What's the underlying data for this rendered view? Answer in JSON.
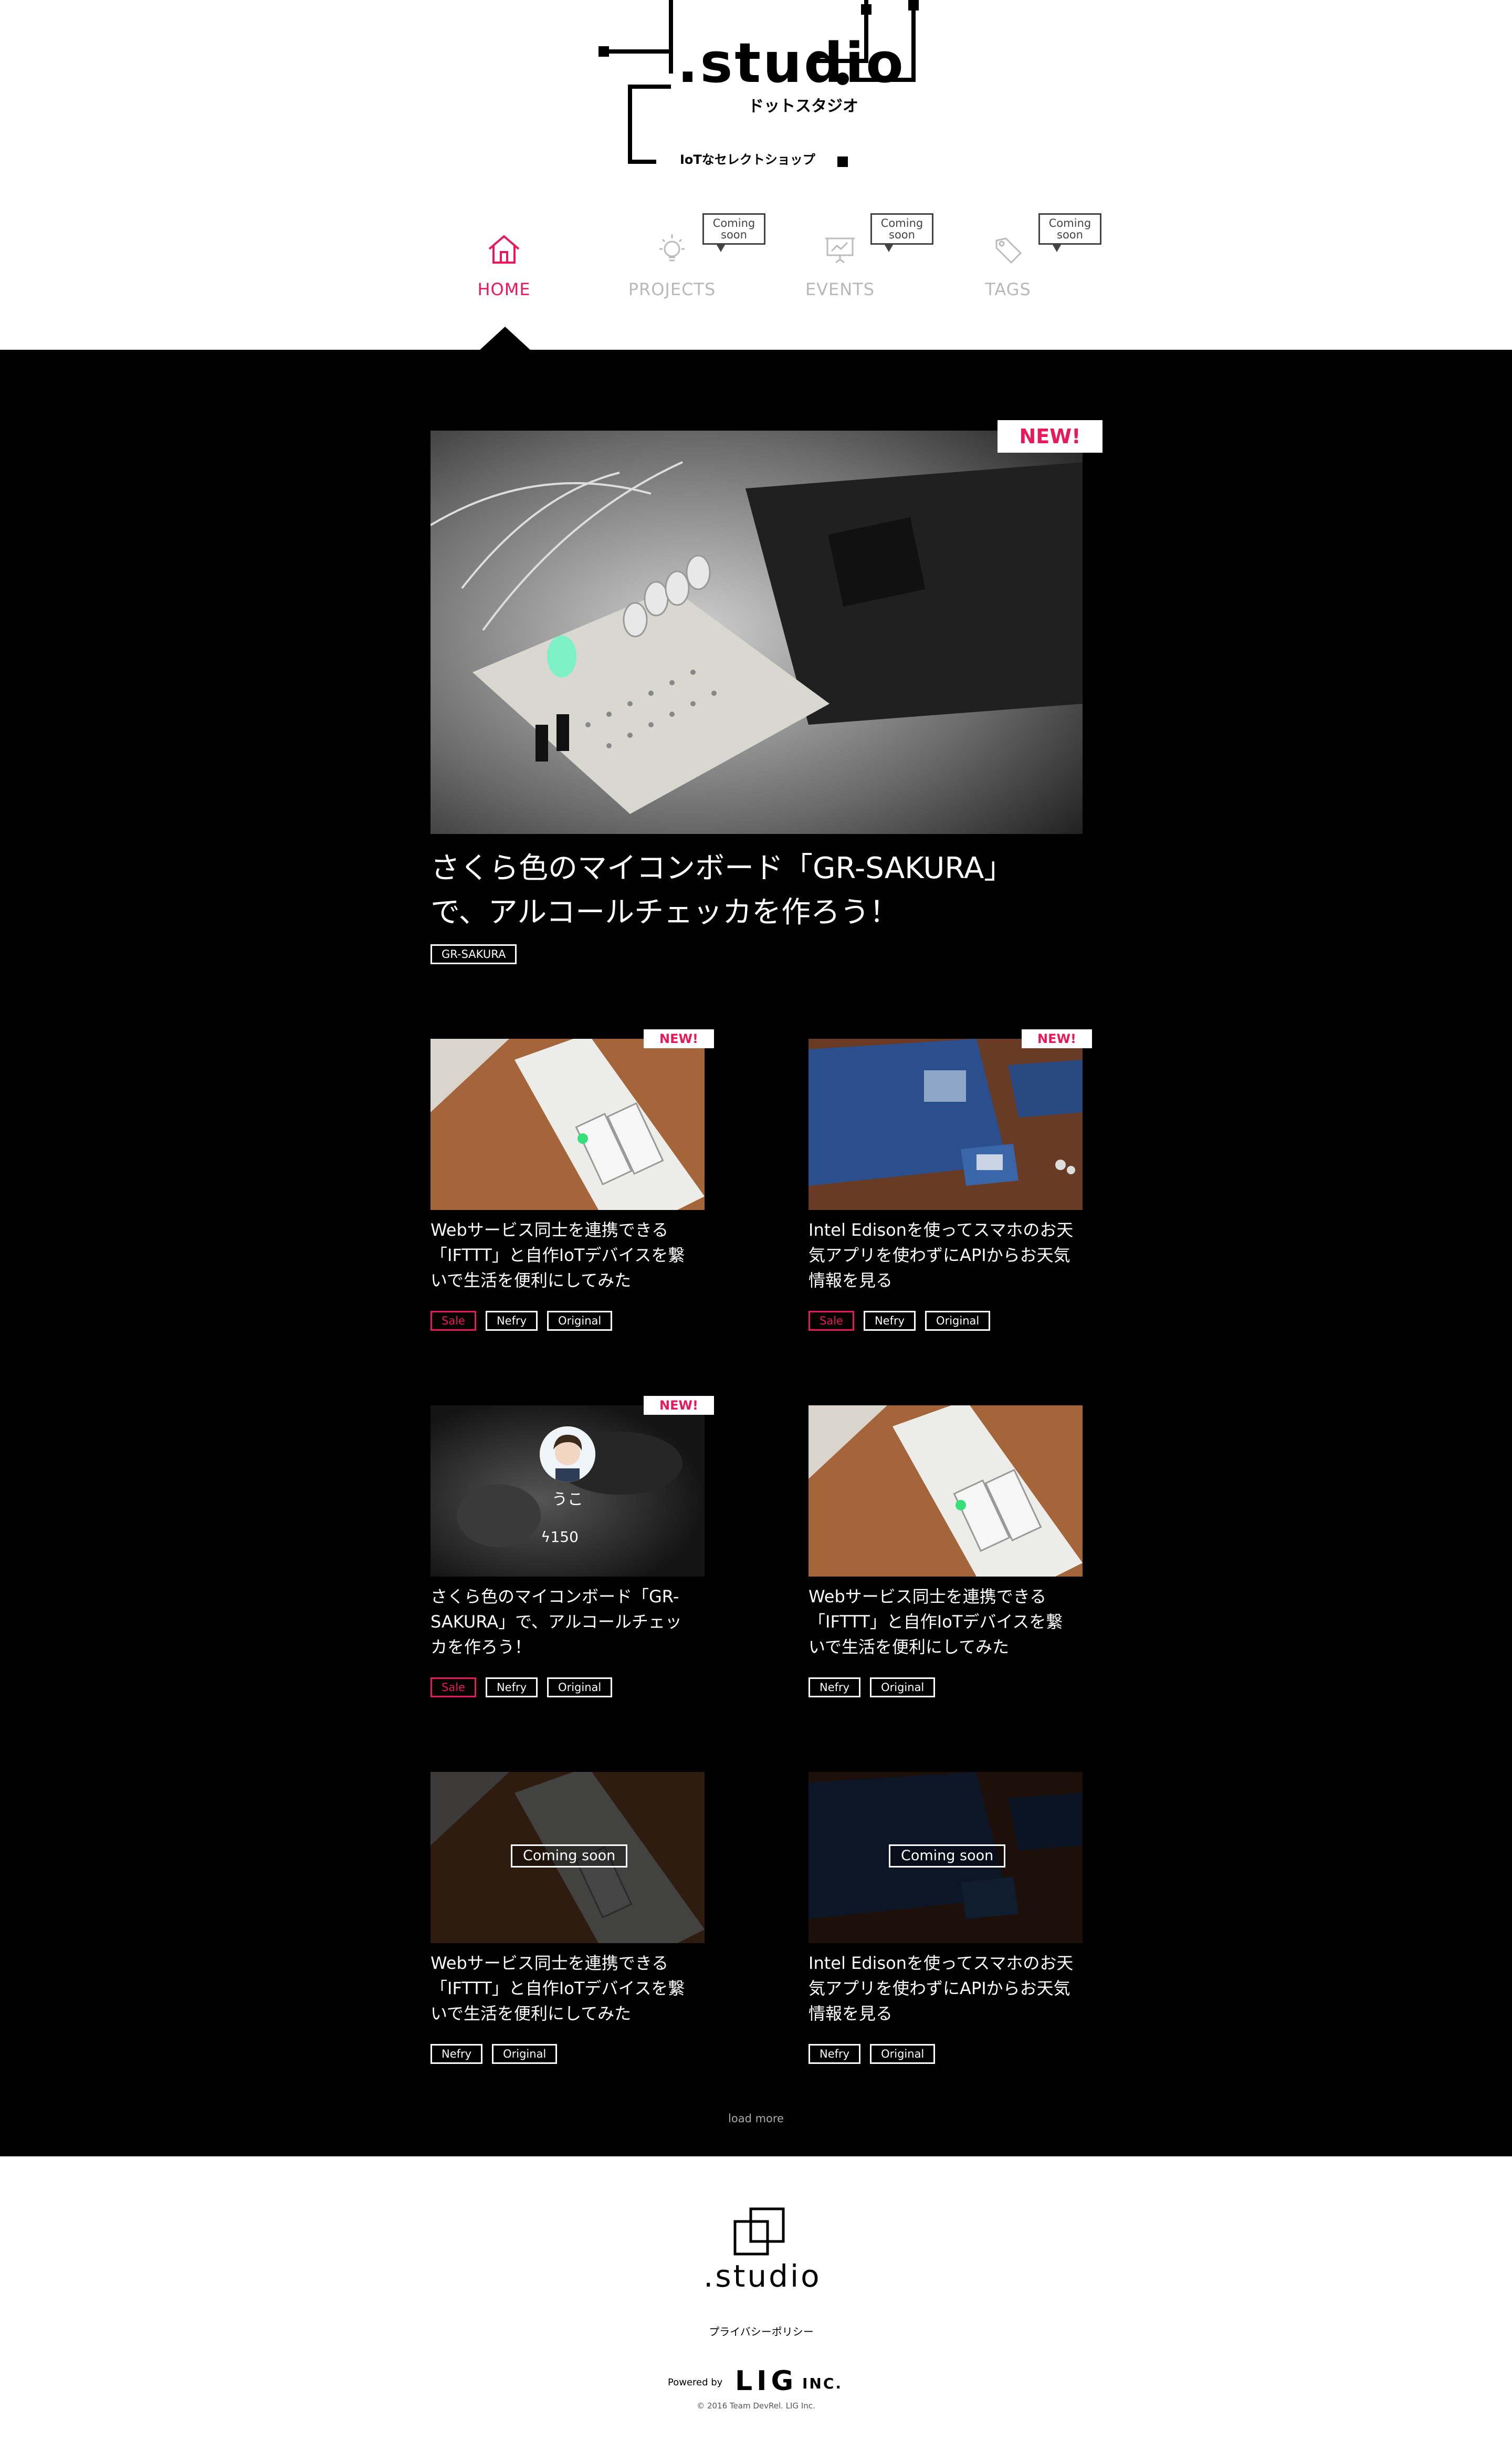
{
  "header": {
    "logo_word": ".studio",
    "logo_kana": "ドットスタジオ",
    "logo_sub": "IoTなセレクトショップ"
  },
  "nav": {
    "items": [
      {
        "label": "HOME",
        "icon": "home-icon",
        "active": true
      },
      {
        "label": "PROJECTS",
        "icon": "lightbulb-icon",
        "badge": "Coming soon"
      },
      {
        "label": "EVENTS",
        "icon": "presentation-icon",
        "badge": "Coming soon"
      },
      {
        "label": "TAGS",
        "icon": "tag-icon",
        "badge": "Coming soon"
      }
    ]
  },
  "colors": {
    "accent": "#e8185b",
    "main_bg": "#000000"
  },
  "featured": {
    "badge": "NEW!",
    "title_line1": "さくら色のマイコンボード「GR-SAKURA」",
    "title_line2": "で、アルコールチェッカを作ろう！",
    "tag": "GR-SAKURA"
  },
  "cards": [
    {
      "badge": "NEW!",
      "title": [
        "Webサービス同士を連携できる",
        "「IFTTT」と自作IoTデバイスを繋",
        "いで生活を便利にしてみた"
      ],
      "tags": [
        "Sale",
        "Nefry",
        "Original"
      ]
    },
    {
      "badge": "NEW!",
      "title": [
        "Intel Edisonを使ってスマホのお天",
        "気アプリを使わずにAPIからお天気",
        "情報を見る"
      ],
      "tags": [
        "Sale",
        "Nefry",
        "Original"
      ]
    },
    {
      "badge": "NEW!",
      "author": "うこ",
      "likes": "150",
      "title": [
        "さくら色のマイコンボード「GR-",
        "SAKURA」で、アルコールチェッ",
        "カを作ろう！"
      ],
      "tags": [
        "Sale",
        "Nefry",
        "Original"
      ]
    },
    {
      "title": [
        "Webサービス同士を連携できる",
        "「IFTTT」と自作IoTデバイスを繋",
        "いで生活を便利にしてみた"
      ],
      "tags": [
        "Nefry",
        "Original"
      ]
    },
    {
      "coming": "Coming soon",
      "title": [
        "Webサービス同士を連携できる",
        "「IFTTT」と自作IoTデバイスを繋",
        "いで生活を便利にしてみた"
      ],
      "tags": [
        "Nefry",
        "Original"
      ]
    },
    {
      "coming": "Coming soon",
      "title": [
        "Intel Edisonを使ってスマホのお天",
        "気アプリを使わずにAPIからお天気",
        "情報を見る"
      ],
      "tags": [
        "Nefry",
        "Original"
      ]
    }
  ],
  "load_more": "load more",
  "footer": {
    "logo": ".studio",
    "privacy": "プライバシーポリシー",
    "powered": "Powered by",
    "lig": "LIG",
    "inc": "INC.",
    "copyright": "© 2016 Team DevRel. LIG Inc."
  }
}
